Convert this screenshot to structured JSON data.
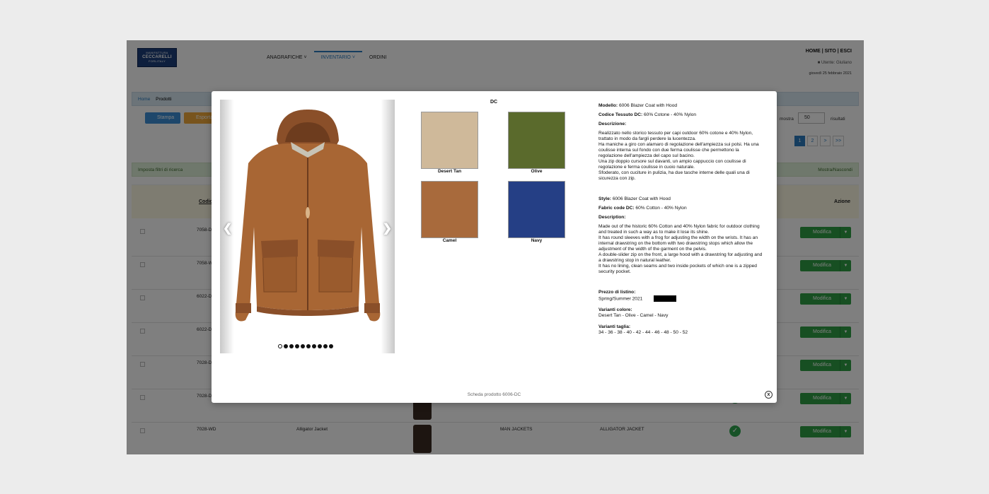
{
  "app": {
    "logo": {
      "line1": "MANIFATTURA",
      "line2": "CECCARELLI",
      "line3": "FORLITALY"
    },
    "nav": [
      {
        "label": "ANAGRAFICHE"
      },
      {
        "label": "INVENTARIO"
      },
      {
        "label": "ORDINI"
      }
    ],
    "toplinks": "HOME | SITO | ESCI",
    "user": "Utente: Giuliano",
    "date": "giovedì 25 febbraio 2021",
    "breadcrumb": {
      "home": "Home",
      "current": "Prodotti"
    },
    "toolbar": {
      "print": "Stampa",
      "export": "Esporta",
      "show_label": "mostra",
      "show_value": "50",
      "results_label": "risultati"
    },
    "pager": [
      "1",
      "2",
      ">",
      ">>"
    ],
    "filter": {
      "left": "Imposta filtri di ricerca",
      "right": "Mostra/Nascondi"
    },
    "table": {
      "header_code": "Codice",
      "header_action": "Azione",
      "edit_label": "Modifica",
      "rows": [
        {
          "code": "7058-DC",
          "name": "",
          "category": "",
          "description": "",
          "thumb": false,
          "ok": false
        },
        {
          "code": "7058-WD",
          "name": "",
          "category": "",
          "description": "",
          "thumb": false,
          "ok": false
        },
        {
          "code": "6022-DC",
          "name": "",
          "category": "",
          "description": "",
          "thumb": false,
          "ok": false
        },
        {
          "code": "6022-DC",
          "name": "",
          "category": "",
          "description": "",
          "thumb": false,
          "ok": false
        },
        {
          "code": "7028-DC",
          "name": "",
          "category": "",
          "description": "",
          "thumb": false,
          "ok": false
        },
        {
          "code": "7028-DC",
          "name": "",
          "category": "",
          "description": "",
          "thumb": true,
          "ok": true
        },
        {
          "code": "7028-WD",
          "name": "Alligator Jacket",
          "category": "MAN JACKETS",
          "description": "ALLIGATOR JACKET",
          "thumb": true,
          "ok": true
        }
      ]
    }
  },
  "modal": {
    "fabric_code": "DC",
    "swatches": [
      {
        "name": "Desert Tan",
        "color": "#cfb99a"
      },
      {
        "name": "Olive",
        "color": "#5a6a2c"
      },
      {
        "name": "Camel",
        "color": "#a86a3c"
      },
      {
        "name": "Navy",
        "color": "#253f85"
      }
    ],
    "it": {
      "model_label": "Modello:",
      "model_value": "6006 Blazer Coat with Hood",
      "fabric_label": "Codice Tessuto DC:",
      "fabric_value": "60% Cotone - 40% Nylon",
      "desc_label": "Descrizione:",
      "desc_text": "Realizzato nello storico tessuto per capi outdoor 60% cotone e 40% Nylon, trattato in modo da fargli perdere la lucentezza.\nHa maniche a giro con alamaro di regolazione dell'ampiezza sui polsi. Ha una coulisse interna sul fondo con due ferma coulisse che permettono la regolazione dell'ampiezza del capo sul bacino.\nUna zip doppio cursore sul davanti, un ampio cappuccio con coulisse di regolazione e ferma coulisse in cuoio naturale.\nSfoderato, con cuciture in pulizia, ha due tasche interne delle quali una di sicurezza con zip."
    },
    "en": {
      "style_label": "Style:",
      "style_value": "6006 Blazer Coat with Hood",
      "fabric_label": "Fabric code DC:",
      "fabric_value": "60% Cotton - 40% Nylon",
      "desc_label": "Description:",
      "desc_text": "Made out of the historic 60% Cotton and 40% Nylon fabric for outdoor clothing and treated in such a way as to make it lose its shine.\nIt has round sleeves with a frog for adjusting the width on the wrists. It has an internal drawstring on the bottom with two drawstring stops which allow the adjustment of the width of the garment on the pelvis.\nA double-slider zip on the front, a large hood with a drawstring for adjusting and a drawstring stop in natural leather.\nIt has no lining, clean seams and two inside pockets of which one is a zipped security pocket."
    },
    "price_label": "Prezzo di listino:",
    "season": "Spring/Summer 2021",
    "color_variants_label": "Varianti colore:",
    "color_variants": "Desert Tan - Olive - Camel - Navy",
    "size_variants_label": "Varianti taglia:",
    "size_variants": "34 - 36 - 38 - 40 - 42 - 44 - 46 - 48 - 50 - 52",
    "gallery_count": 10,
    "gallery_active": 1,
    "footer": "Scheda prodotto 6006-DC",
    "close_label": "x"
  }
}
